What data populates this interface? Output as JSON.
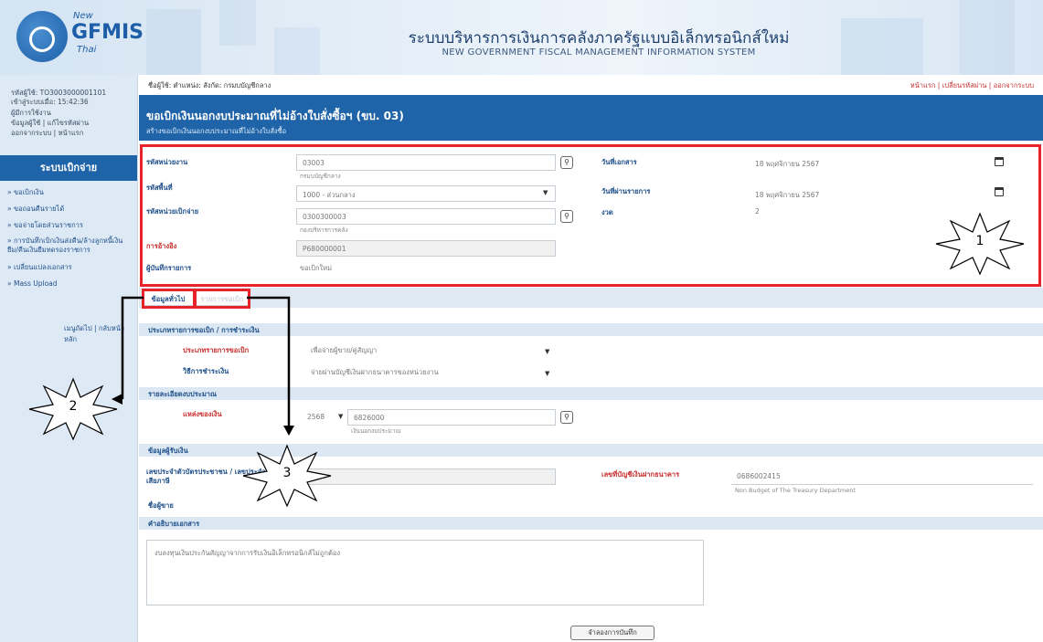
{
  "header": {
    "logo": {
      "new": "New",
      "gfmis": "GFMIS",
      "thai": "Thai"
    },
    "title_th": "ระบบบริหารการเงินการคลังภาครัฐแบบอิเล็กทรอนิกส์ใหม่",
    "title_en": "NEW GOVERNMENT FISCAL MANAGEMENT INFORMATION SYSTEM"
  },
  "sidebar": {
    "info": [
      "รหัสผู้ใช้: TO3003000001101",
      "เข้าสู่ระบบเมื่อ: 15:42:36",
      "ผู้มีการใช้งาน",
      "ข้อมูลผู้ใช้ | แก้ไขรหัสผ่าน",
      "ออกจากระบบ | หน้าแรก"
    ],
    "title": "ระบบเบิกจ่าย",
    "menu": [
      "» ขอเบิกเงิน",
      "» ขอถอนคืนรายได้",
      "» ขอจ่ายโดยส่วนราชการ",
      "» การบันทึกเบิกเงินส่งคืน/ล้างลูกหนี้เงิน ยืม/คืนเงินยืมทดรองราชการ",
      "» เปลี่ยนแปลงเอกสาร",
      "» Mass Upload"
    ],
    "back_link": "เมนูถัดไป | กลับหน้าหลัก"
  },
  "topbar": {
    "crumb": "ชื่อผู้ใช้: ตำแหน่ง: สังกัด: กรมบบัญชีกลาง",
    "links": "หน้าแรก | เปลี่ยนรหัสผ่าน | ออกจากระบบ"
  },
  "banner": {
    "title": "ขอเบิกเงินนอกงบประมาณที่ไม่อ้างใบสั่งซื้อฯ (ขบ. 03)",
    "subtitle": "สร้างขอเบิกเงินนอกงบประมาณที่ไม่อ้างใบสั่งซื้อ"
  },
  "form": {
    "agency_label": "รหัสหน่วยงาน",
    "agency_value": "03003",
    "agency_sub": "กรมบบัญชีกลาง",
    "area_label": "รหัสพื้นที่",
    "area_value": "1000 - ส่วนกลาง",
    "disb_label": "รหัสหน่วยเบิกจ่าย",
    "disb_value": "0300300003",
    "disb_sub": "กองบริหารการคลัง",
    "ref_label": "การอ้างอิง",
    "ref_value": "P680000001",
    "doc_label": "ผู้บันทึกรายการ",
    "doc_value": "ขอเบิกใหม่",
    "doc_date_label": "วันที่เอกสาร",
    "doc_date_value": "18 พฤศจิกายน 2567",
    "post_date_label": "วันที่ผ่านรายการ",
    "post_date_value": "18 พฤศจิกายน 2567",
    "period_label": "งวด",
    "period_value": "2"
  },
  "tabs": [
    "ข้อมูลทั่วไป",
    "รายการขอเบิก"
  ],
  "general": {
    "sec1": "ประเภทรายการขอเบิก / การชำระเงิน",
    "type_label": "ประเภทรายการขอเบิก",
    "type_value": "เพื่อจ่ายผู้ขาย/คู่สัญญา",
    "pay_label": "วิธีการชำระเงิน",
    "pay_value": "จ่ายผ่านบัญชีเงินฝากธนาคารของหน่วยงาน",
    "sec2": "รายละเอียดงบประมาณ",
    "source_label": "แหล่งของเงิน",
    "year_value": "2568",
    "source_value": "6826000",
    "source_sub": "เงินนอกงบประมาณ",
    "sec3": "ข้อมูลผู้รับเงิน",
    "taxid_label": "เลขประจำตัวบัตรประชาชน / เลขประจำตัวผู้เสียภาษี",
    "bank_label": "เลขที่บัญชีเงินฝากธนาคาร",
    "bank_value": "0686002415",
    "bank_sub": "Non Budget of The Treasury Department",
    "sec_payee": "ชื่อผู้ขาย",
    "sec4": "คำอธิบายเอกสาร",
    "remark": "งบลงทุนเงินประกันสัญญาจากการรับเงินอิเล็กทรอนิกส์ไม่ถูกต้อง",
    "save_label": "จำลองการบันทึก"
  },
  "callouts": [
    "1",
    "2",
    "3"
  ],
  "colors": {
    "accent": "#1f63a8",
    "highlight": "#e8232a"
  }
}
